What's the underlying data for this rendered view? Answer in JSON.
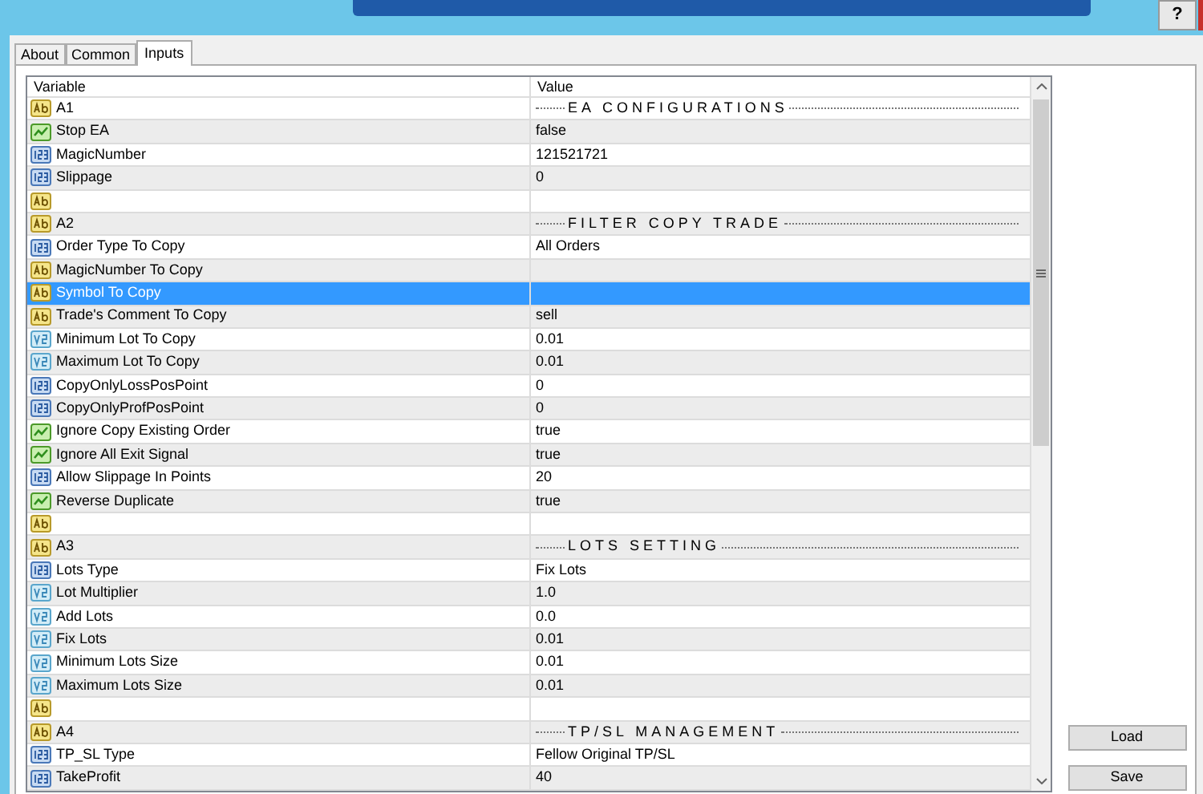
{
  "window": {
    "help_button": "?"
  },
  "tabs": [
    {
      "label": "About",
      "selected": false
    },
    {
      "label": "Common",
      "selected": false
    },
    {
      "label": "Inputs",
      "selected": true
    }
  ],
  "table": {
    "columns": [
      "Variable",
      "Value"
    ],
    "rows": [
      {
        "kind": "string",
        "variable": "A1",
        "value": "EA CONFIGURATIONS",
        "separator": true,
        "selected": false
      },
      {
        "kind": "bool",
        "variable": "Stop EA",
        "value": "false",
        "separator": false,
        "selected": false
      },
      {
        "kind": "int",
        "variable": "MagicNumber",
        "value": "121521721",
        "separator": false,
        "selected": false
      },
      {
        "kind": "int",
        "variable": "Slippage",
        "value": "0",
        "separator": false,
        "selected": false
      },
      {
        "kind": "string",
        "variable": "",
        "value": "",
        "separator": false,
        "selected": false
      },
      {
        "kind": "string",
        "variable": "A2",
        "value": "FILTER COPY TRADE",
        "separator": true,
        "selected": false
      },
      {
        "kind": "int",
        "variable": "Order Type To Copy",
        "value": "All Orders",
        "separator": false,
        "selected": false
      },
      {
        "kind": "string",
        "variable": "MagicNumber To Copy",
        "value": "",
        "separator": false,
        "selected": false
      },
      {
        "kind": "string",
        "variable": "Symbol To Copy",
        "value": "",
        "separator": false,
        "selected": true
      },
      {
        "kind": "string",
        "variable": "Trade's Comment To Copy",
        "value": "sell",
        "separator": false,
        "selected": false
      },
      {
        "kind": "double",
        "variable": "Minimum Lot To Copy",
        "value": "0.01",
        "separator": false,
        "selected": false
      },
      {
        "kind": "double",
        "variable": "Maximum Lot To Copy",
        "value": "0.01",
        "separator": false,
        "selected": false
      },
      {
        "kind": "int",
        "variable": "CopyOnlyLossPosPoint",
        "value": "0",
        "separator": false,
        "selected": false
      },
      {
        "kind": "int",
        "variable": "CopyOnlyProfPosPoint",
        "value": "0",
        "separator": false,
        "selected": false
      },
      {
        "kind": "bool",
        "variable": "Ignore Copy Existing Order",
        "value": "true",
        "separator": false,
        "selected": false
      },
      {
        "kind": "bool",
        "variable": "Ignore All Exit Signal",
        "value": "true",
        "separator": false,
        "selected": false
      },
      {
        "kind": "int",
        "variable": "Allow Slippage In Points",
        "value": "20",
        "separator": false,
        "selected": false
      },
      {
        "kind": "bool",
        "variable": "Reverse Duplicate",
        "value": "true",
        "separator": false,
        "selected": false
      },
      {
        "kind": "string",
        "variable": "",
        "value": "",
        "separator": false,
        "selected": false
      },
      {
        "kind": "string",
        "variable": "A3",
        "value": "LOTS SETTING",
        "separator": true,
        "selected": false
      },
      {
        "kind": "int",
        "variable": "Lots Type",
        "value": "Fix Lots",
        "separator": false,
        "selected": false
      },
      {
        "kind": "double",
        "variable": "Lot Multiplier",
        "value": "1.0",
        "separator": false,
        "selected": false
      },
      {
        "kind": "double",
        "variable": "Add Lots",
        "value": "0.0",
        "separator": false,
        "selected": false
      },
      {
        "kind": "double",
        "variable": "Fix Lots",
        "value": "0.01",
        "separator": false,
        "selected": false
      },
      {
        "kind": "double",
        "variable": "Minimum Lots Size",
        "value": "0.01",
        "separator": false,
        "selected": false
      },
      {
        "kind": "double",
        "variable": "Maximum Lots Size",
        "value": "0.01",
        "separator": false,
        "selected": false
      },
      {
        "kind": "string",
        "variable": "",
        "value": "",
        "separator": false,
        "selected": false
      },
      {
        "kind": "string",
        "variable": "A4",
        "value": "TP/SL MANAGEMENT",
        "separator": true,
        "selected": false
      },
      {
        "kind": "int",
        "variable": "TP_SL Type",
        "value": "Fellow Original TP/SL",
        "separator": false,
        "selected": false
      },
      {
        "kind": "int",
        "variable": "TakeProfit",
        "value": "40",
        "separator": false,
        "selected": false
      }
    ]
  },
  "buttons": [
    "Load",
    "Save"
  ]
}
